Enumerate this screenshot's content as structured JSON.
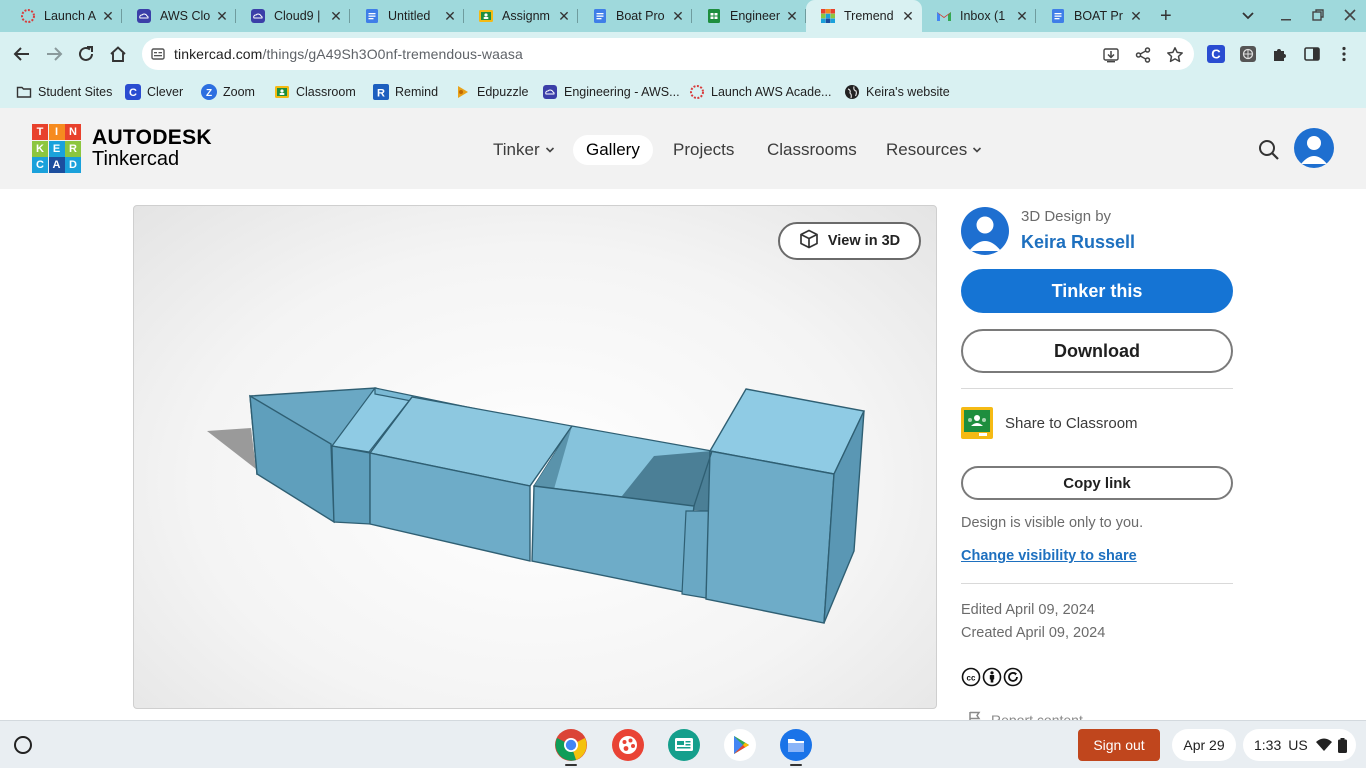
{
  "browser": {
    "tabs": [
      {
        "title": "Launch A",
        "icon": "aws-academy-icon"
      },
      {
        "title": "AWS Clo",
        "icon": "cloud-icon"
      },
      {
        "title": "Cloud9 |",
        "icon": "cloud-icon"
      },
      {
        "title": "Untitled",
        "icon": "docs-icon"
      },
      {
        "title": "Assignm",
        "icon": "classroom-icon"
      },
      {
        "title": "Boat Pro",
        "icon": "docs-icon"
      },
      {
        "title": "Engineer",
        "icon": "sheets-icon"
      },
      {
        "title": "Tremend",
        "icon": "tinkercad-icon",
        "active": true
      },
      {
        "title": "Inbox (1",
        "icon": "gmail-icon"
      },
      {
        "title": "BOAT Pr",
        "icon": "docs-icon"
      }
    ],
    "url": {
      "host": "tinkercad.com",
      "path": "/things/gA49Sh3O0nf-tremendous-waasa"
    },
    "bookmarks": [
      {
        "label": "Student Sites",
        "icon": "folder-icon"
      },
      {
        "label": "Clever",
        "icon": "clever-icon"
      },
      {
        "label": "Zoom",
        "icon": "zoom-icon"
      },
      {
        "label": "Classroom",
        "icon": "classroom-icon"
      },
      {
        "label": "Remind",
        "icon": "remind-icon"
      },
      {
        "label": "Edpuzzle",
        "icon": "edpuzzle-icon"
      },
      {
        "label": "Engineering - AWS...",
        "icon": "cloud-icon"
      },
      {
        "label": "Launch AWS Acade...",
        "icon": "aws-academy-icon"
      },
      {
        "label": "Keira's website",
        "icon": "globe-icon"
      }
    ]
  },
  "site": {
    "logo_letters": [
      "T",
      "I",
      "N",
      "K",
      "E",
      "R",
      "C",
      "A",
      "D"
    ],
    "brand_top": "AUTODESK",
    "brand_bottom": "Tinkercad",
    "nav": {
      "tinker": "Tinker",
      "gallery": "Gallery",
      "projects": "Projects",
      "classrooms": "Classrooms",
      "resources": "Resources"
    }
  },
  "design": {
    "view_in_3d": "View in 3D",
    "design_by": "3D Design by",
    "author": "Keira Russell",
    "tinker_this": "Tinker this",
    "download": "Download",
    "share_to_classroom": "Share to Classroom",
    "copy_link": "Copy link",
    "visibility_note": "Design is visible only to you.",
    "change_visibility": "Change visibility to share",
    "edited": "Edited April 09, 2024",
    "created": "Created April 09, 2024",
    "report": "Report content"
  },
  "shelf": {
    "sign_out": "Sign out",
    "date": "Apr 29",
    "time": "1:33",
    "keyboard": "US"
  },
  "colors": {
    "tab_strip": "#9fd9dc",
    "toolbar": "#d9f1f2",
    "primary_button": "#1574d4",
    "link": "#1e70bf",
    "sign_out": "#c0461d"
  }
}
